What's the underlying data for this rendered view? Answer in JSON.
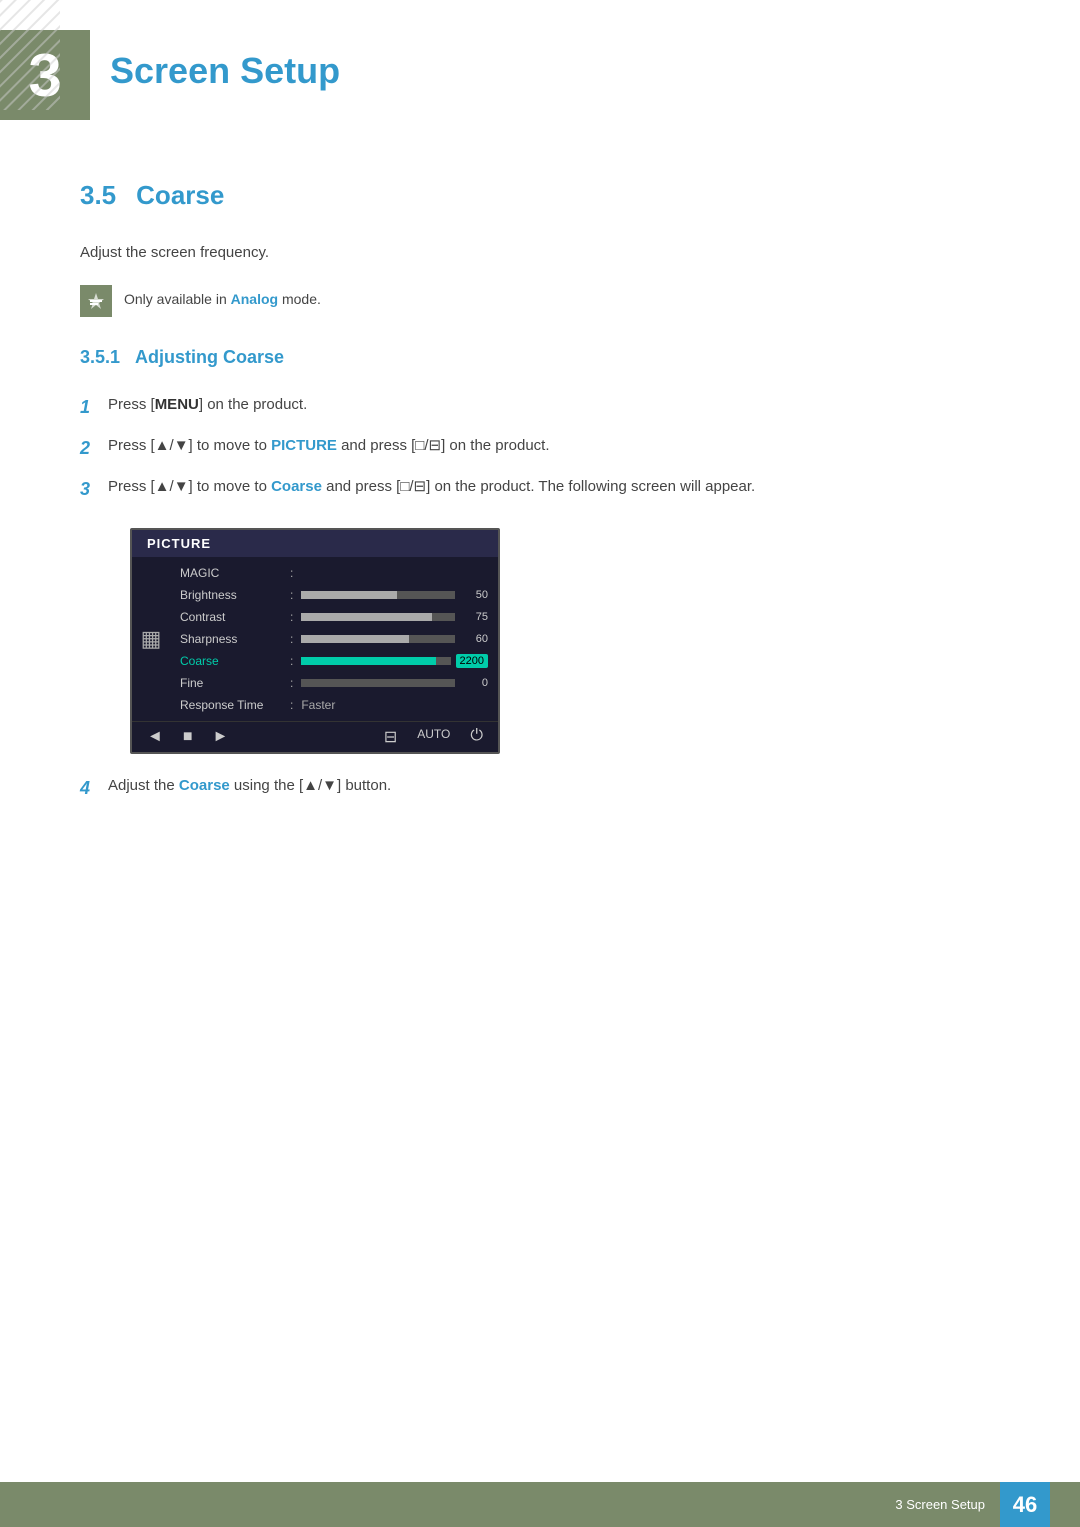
{
  "header": {
    "chapter_number": "3",
    "chapter_title": "Screen Setup"
  },
  "section": {
    "number": "3.5",
    "title": "Coarse",
    "description": "Adjust the screen frequency.",
    "note": {
      "text_before": "Only available in ",
      "highlight": "Analog",
      "text_after": " mode."
    }
  },
  "subsection": {
    "number": "3.5.1",
    "title": "Adjusting Coarse"
  },
  "steps": [
    {
      "number": "1",
      "text": "Press [MENU] on the product."
    },
    {
      "number": "2",
      "text_parts": [
        "Press [▲/▼] to move to ",
        "PICTURE",
        " and press [□/⊟] on the product."
      ]
    },
    {
      "number": "3",
      "text_parts": [
        "Press [▲/▼] to move to ",
        "Coarse",
        " and press [□/⊟] on the product. The following screen will appear."
      ]
    },
    {
      "number": "4",
      "text_parts": [
        "Adjust the ",
        "Coarse",
        " using the [▲/▼] button."
      ]
    }
  ],
  "monitor_menu": {
    "title": "PICTURE",
    "items": [
      {
        "name": "MAGIC",
        "type": "empty",
        "value": ""
      },
      {
        "name": "Brightness",
        "type": "bar",
        "fill_pct": 62,
        "value": "50",
        "cyan": false
      },
      {
        "name": "Contrast",
        "type": "bar",
        "fill_pct": 85,
        "value": "75",
        "cyan": false
      },
      {
        "name": "Sharpness",
        "type": "bar",
        "fill_pct": 70,
        "value": "60",
        "cyan": false
      },
      {
        "name": "Coarse",
        "type": "bar",
        "fill_pct": 90,
        "value": "2200",
        "cyan": true,
        "selected": true
      },
      {
        "name": "Fine",
        "type": "bar",
        "fill_pct": 0,
        "value": "0",
        "cyan": false
      },
      {
        "name": "Response Time",
        "type": "text",
        "value": "Faster"
      }
    ],
    "bottom_icons": [
      "◄",
      "■",
      "►",
      "⊟",
      "AUTO",
      "⏻"
    ]
  },
  "footer": {
    "section_label": "3 Screen Setup",
    "page_number": "46"
  }
}
